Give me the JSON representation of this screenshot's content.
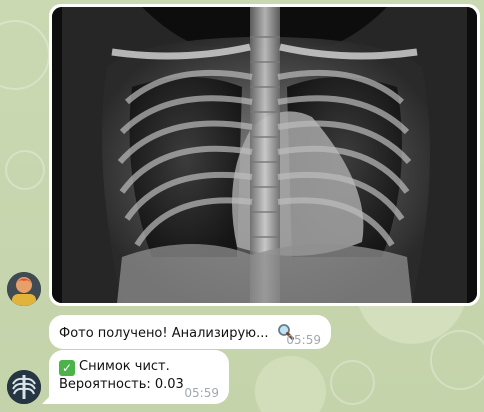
{
  "chat": {
    "photo": {
      "alt": "chest x-ray"
    },
    "messages": [
      {
        "text": "Фото получено! Анализирую...",
        "icon": "magnifier-icon",
        "time": "05:59"
      },
      {
        "status_icon": "check-mark-icon",
        "line1": "Снимок чист.",
        "line2": "Вероятность: 0.03",
        "time": "05:59"
      }
    ]
  },
  "colors": {
    "background": "#c9d7b1",
    "bubble": "#ffffff",
    "time": "#a1a9b0",
    "check": "#4cb34a"
  }
}
